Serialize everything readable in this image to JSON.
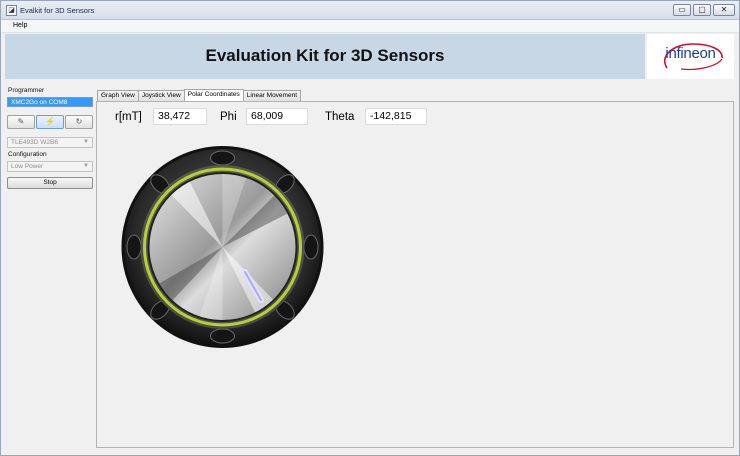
{
  "window": {
    "title": "Evalkit for 3D Sensors",
    "controls": [
      "▭",
      "▢",
      "✕"
    ]
  },
  "menu": {
    "items": [
      "Help"
    ]
  },
  "banner": {
    "title": "Evaluation Kit for 3D Sensors",
    "logo_text": "infineon"
  },
  "sidebar": {
    "programmer_label": "Programmer",
    "programmer_selected": "XMC2Go on COM8",
    "tools": [
      {
        "icon": "pencil-icon",
        "glyph": "✎"
      },
      {
        "icon": "connect-icon",
        "glyph": "⚡"
      },
      {
        "icon": "refresh-icon",
        "glyph": "↻"
      }
    ],
    "sensor_value": "TLE493D W2B6",
    "configuration_label": "Configuration",
    "configuration_value": "Low Power",
    "stop_label": "Stop"
  },
  "tabs": [
    "Graph View",
    "Joystick View",
    "Polar Coordinates",
    "Linear Movement"
  ],
  "active_tab": "Polar Coordinates",
  "polar": {
    "r_label": "r[mT]",
    "r_value": "38,472",
    "phi_label": "Phi",
    "phi_value": "68,009",
    "theta_label": "Theta",
    "theta_value": "-142,815"
  },
  "colors": {
    "banner_bg": "#c8d7e6",
    "selection": "#3399ff",
    "knob_ring": "#b5d32a",
    "logo_blue": "#1f3f8f",
    "logo_red": "#d0102a"
  }
}
